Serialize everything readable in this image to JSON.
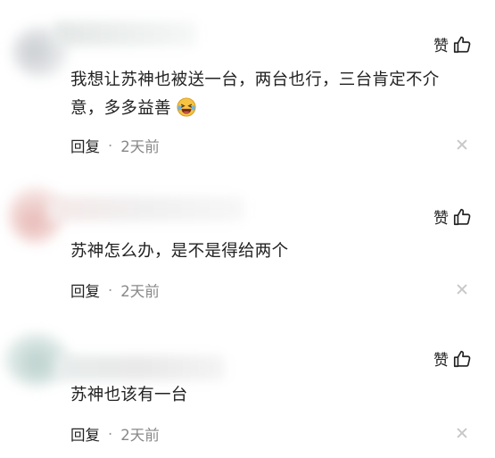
{
  "comments": [
    {
      "like_label": "赞",
      "text_line1": "我想让苏神也被送一台，两台也行，三台肯定不介",
      "text_line2": "意，多多益善",
      "emoji": "laughing-face-emoji",
      "reply_label": "回复",
      "separator": "·",
      "time": "2天前"
    },
    {
      "like_label": "赞",
      "text_line1": "苏神怎么办，是不是得给两个",
      "reply_label": "回复",
      "separator": "·",
      "time": "2天前"
    },
    {
      "like_label": "赞",
      "text_line1": "苏神也该有一台",
      "reply_label": "回复",
      "separator": "·",
      "time": "2天前"
    }
  ],
  "icons": {
    "like": "thumbs-up-icon",
    "close": "close-icon"
  },
  "colors": {
    "text": "#222222",
    "muted": "#888888",
    "close": "#c8c8c8",
    "emoji": "#f6c343"
  }
}
